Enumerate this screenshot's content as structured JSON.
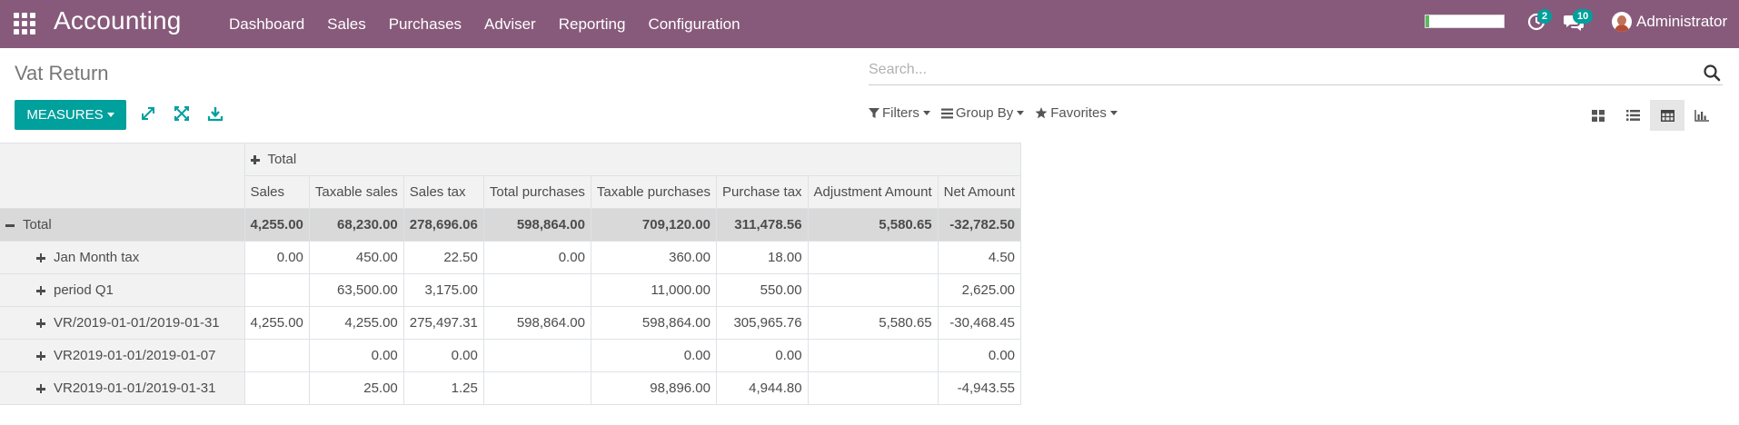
{
  "app": {
    "title": "Accounting",
    "menu": [
      "Dashboard",
      "Sales",
      "Purchases",
      "Adviser",
      "Reporting",
      "Configuration"
    ],
    "progress_percent": 5,
    "activity_count": "2",
    "message_count": "10",
    "user_name": "Administrator"
  },
  "page": {
    "title": "Vat Return",
    "search_placeholder": "Search..."
  },
  "toolbar": {
    "measures_label": "MEASURES",
    "filters_label": "Filters",
    "groupby_label": "Group By",
    "favorites_label": "Favorites",
    "icons": [
      "expand-arrows-icon",
      "collapse-icon",
      "download-icon"
    ],
    "views": [
      "kanban-view-icon",
      "list-view-icon",
      "pivot-view-icon",
      "graph-view-icon"
    ],
    "active_view": "pivot"
  },
  "pivot": {
    "col_group_label": "Total",
    "measures": [
      "Sales",
      "Taxable sales",
      "Sales tax",
      "Total purchases",
      "Taxable purchases",
      "Purchase tax",
      "Adjustment Amount",
      "Net Amount"
    ],
    "total_row": {
      "label": "Total",
      "values": [
        "4,255.00",
        "68,230.00",
        "278,696.06",
        "598,864.00",
        "709,120.00",
        "311,478.56",
        "5,580.65",
        "-32,782.50"
      ]
    },
    "rows": [
      {
        "label": "Jan Month tax",
        "values": [
          "0.00",
          "450.00",
          "22.50",
          "0.00",
          "360.00",
          "18.00",
          "",
          "4.50"
        ]
      },
      {
        "label": "period Q1",
        "values": [
          "",
          "63,500.00",
          "3,175.00",
          "",
          "11,000.00",
          "550.00",
          "",
          "2,625.00"
        ]
      },
      {
        "label": "VR/2019-01-01/2019-01-31",
        "values": [
          "4,255.00",
          "4,255.00",
          "275,497.31",
          "598,864.00",
          "598,864.00",
          "305,965.76",
          "5,580.65",
          "-30,468.45"
        ]
      },
      {
        "label": "VR2019-01-01/2019-01-07",
        "values": [
          "",
          "0.00",
          "0.00",
          "",
          "0.00",
          "0.00",
          "",
          "0.00"
        ]
      },
      {
        "label": "VR2019-01-01/2019-01-31",
        "values": [
          "",
          "25.00",
          "1.25",
          "",
          "98,896.00",
          "4,944.80",
          "",
          "-4,943.55"
        ]
      }
    ]
  },
  "colors": {
    "navbar": "#875a7b",
    "primary": "#00a09d",
    "header_bg": "#f2f2f2",
    "total_row_bg": "#d9d9d9"
  }
}
